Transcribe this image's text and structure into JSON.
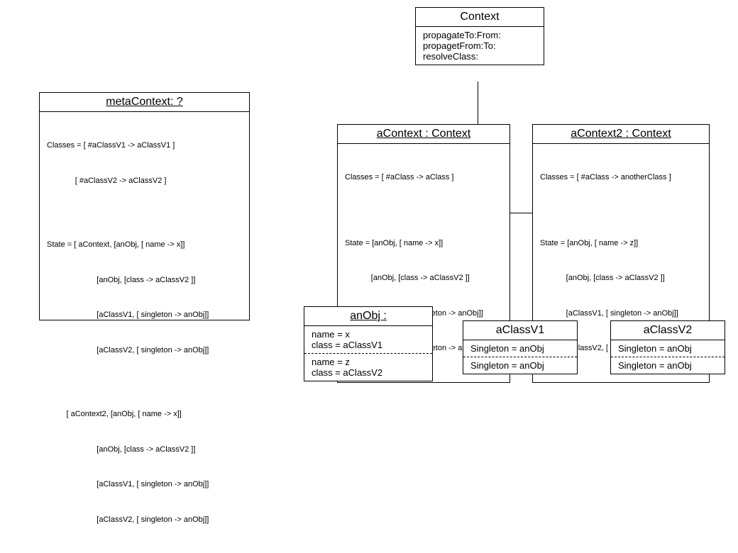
{
  "contextClass": {
    "title": "Context",
    "methods": [
      "propagateTo:From:",
      "propagetFrom:To:",
      "resolveClass:"
    ]
  },
  "metaContext": {
    "title": "metaContext: ?",
    "classesLabel": "Classes = [ #aClassV1 -> aClassV1 ]",
    "classes2": "             [ #aClassV2 -> aClassV2 ]",
    "stateHeader": "State = [ aContext, [anObj, [ name -> x]]",
    "stateLines": [
      "                       [anObj, [class -> aClassV2 ]]",
      "                       [aClassV1, [ singleton -> anObj]]",
      "                       [aClassV2, [ singleton -> anObj]]"
    ],
    "stateHeader2": "         [ aContext2, [anObj, [ name -> x]]",
    "stateLines2": [
      "                       [anObj, [class -> aClassV2 ]]",
      "                       [aClassV1, [ singleton -> anObj]]",
      "                       [aClassV2, [ singleton -> anObj]]"
    ]
  },
  "aContext": {
    "title": "aContext : Context",
    "classesLabel": "Classes = [ #aClass -> aClass ]",
    "stateHeader": "State = [anObj, [ name -> x]]",
    "stateLines": [
      "            [anObj, [class -> aClassV2 ]]",
      "            [aClassV1, [ singleton -> anObj]]",
      "            [aClassV2, [ singleton -> anObj]]"
    ]
  },
  "aContext2": {
    "title": "aContext2 : Context",
    "classesLabel": "Classes = [ #aClass -> anotherClass ]",
    "stateHeader": "State = [anObj, [ name -> z]]",
    "stateLines": [
      "            [anObj, [class -> aClassV2 ]]",
      "            [aClassV1, [ singleton -> anObj]]",
      "            [aClassV2, [ singleton -> anObj]]"
    ]
  },
  "anObj": {
    "title": "anObj :",
    "top": [
      "name = x",
      "class = aClassV1"
    ],
    "bottom": [
      "name = z",
      "class = aClassV2"
    ]
  },
  "aClassV1": {
    "title": "aClassV1",
    "top": "Singleton = anObj",
    "bottom": "Singleton = anObj"
  },
  "aClassV2": {
    "title": "aClassV2",
    "top": "Singleton = anObj",
    "bottom": "Singleton = anObj"
  }
}
